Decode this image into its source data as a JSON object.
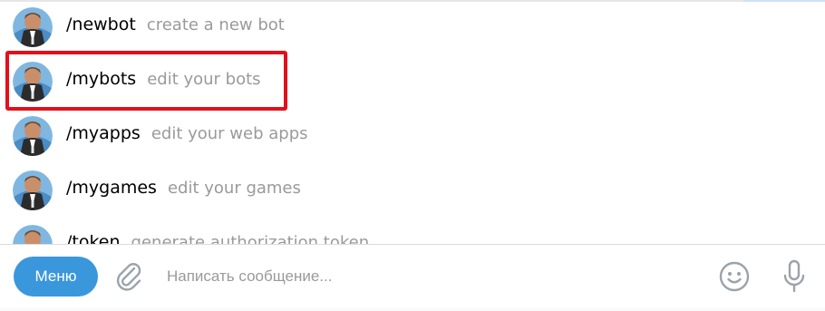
{
  "commands": [
    {
      "command": "/newbot",
      "description": "create a new bot"
    },
    {
      "command": "/mybots",
      "description": "edit your bots"
    },
    {
      "command": "/myapps",
      "description": "edit your web apps"
    },
    {
      "command": "/mygames",
      "description": "edit your games"
    },
    {
      "command": "/token",
      "description": "generate authorization token"
    }
  ],
  "highlighted_command": "/mybots",
  "composer": {
    "menu_label": "Меню",
    "placeholder": "Написать сообщение..."
  },
  "colors": {
    "accent": "#3a97dc",
    "highlight_border": "#e2101b",
    "description_text": "#9a9a9a"
  },
  "icons": {
    "avatar": "bot-avatar-icon",
    "attach": "paperclip-icon",
    "emoji": "smiley-icon",
    "voice": "microphone-icon"
  }
}
